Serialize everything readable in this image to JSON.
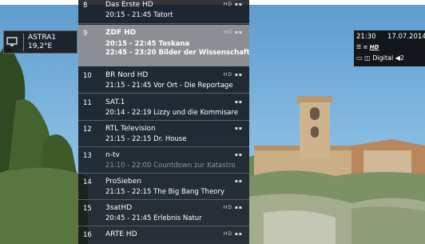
{
  "satellite": {
    "name": "ASTRA1",
    "position": "19,2°E",
    "icon": "tv-set-icon"
  },
  "info": {
    "time": "21:30",
    "date": "17.07.2014",
    "hd_badge": "HD",
    "digital_label": "Digital",
    "audio_channels": "2"
  },
  "channels": [
    {
      "num": "8",
      "name": "Das Erste HD",
      "programs": [
        "20:15 - 21:45  Tatort"
      ],
      "badges": "HD ▪▪",
      "faded": false
    },
    {
      "num": "9",
      "name": "ZDF HD",
      "programs": [
        "20:15 - 22:45  Toskana",
        "22:45 - 23:20  Bilder der Wissenschaft"
      ],
      "badges": "HD ▪▪",
      "selected": true
    },
    {
      "num": "10",
      "name": "BR Nord HD",
      "programs": [
        "21:15 - 21:45  Vor Ort - Die Reportage"
      ],
      "badges": "HD ▪▪"
    },
    {
      "num": "11",
      "name": "SAT.1",
      "programs": [
        "20:14 - 22:19  Lizzy und die Kommisare"
      ],
      "badges": "▪▪"
    },
    {
      "num": "12",
      "name": "RTL Television",
      "programs": [
        "21:15 - 22:15  Dr. House"
      ],
      "badges": "▪▪"
    },
    {
      "num": "13",
      "name": "n-tv",
      "programs": [
        "21:10 - 22:00  Countdown zur Katastro"
      ],
      "badges": "▪▪",
      "faded": true
    },
    {
      "num": "14",
      "name": "ProSieben",
      "programs": [
        "21:15 - 22:15  The Big Bang Theory"
      ],
      "badges": "▪▪"
    },
    {
      "num": "15",
      "name": "3satHD",
      "programs": [
        "20:45 - 21:45  Erlebnis Natur"
      ],
      "badges": "HD ▪▪"
    },
    {
      "num": "16",
      "name": "ARTE HD",
      "programs": [],
      "badges": "HD ▪▪"
    }
  ]
}
